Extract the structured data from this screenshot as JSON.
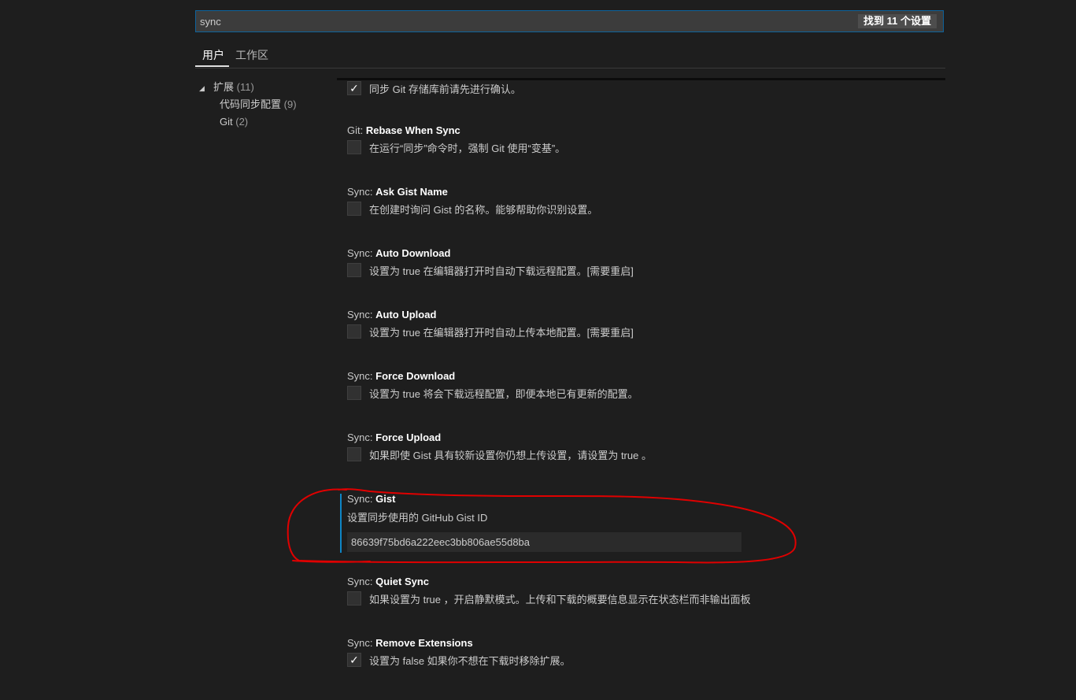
{
  "search": {
    "value": "sync",
    "result_count": "找到 11 个设置"
  },
  "tabs": [
    {
      "label": "用户"
    },
    {
      "label": "工作区"
    }
  ],
  "tree": {
    "root": {
      "label": "扩展",
      "count": "(11)"
    },
    "children": [
      {
        "label": "代码同步配置",
        "count": "(9)"
      },
      {
        "label": "Git",
        "count": "(2)"
      }
    ]
  },
  "settings": [
    {
      "category": "",
      "name": "",
      "checked": true,
      "checkmark": "✓",
      "description": "同步 Git 存储库前请先进行确认。"
    },
    {
      "category": "Git: ",
      "name": "Rebase When Sync",
      "checked": false,
      "checkmark": "",
      "description": "在运行“同步”命令时，强制 Git 使用“变基”。"
    },
    {
      "category": "Sync: ",
      "name": "Ask Gist Name",
      "checked": false,
      "checkmark": "",
      "description": "在创建时询问 Gist 的名称。能够帮助你识别设置。"
    },
    {
      "category": "Sync: ",
      "name": "Auto Download",
      "checked": false,
      "checkmark": "",
      "description": "设置为 true 在编辑器打开时自动下载远程配置。[需要重启]"
    },
    {
      "category": "Sync: ",
      "name": "Auto Upload",
      "checked": false,
      "checkmark": "",
      "description": "设置为 true 在编辑器打开时自动上传本地配置。[需要重启]"
    },
    {
      "category": "Sync: ",
      "name": "Force Download",
      "checked": false,
      "checkmark": "",
      "description": "设置为 true 将会下载远程配置，即便本地已有更新的配置。"
    },
    {
      "category": "Sync: ",
      "name": "Force Upload",
      "checked": false,
      "checkmark": "",
      "description": "如果即使 Gist 具有较新设置你仍想上传设置，请设置为 true 。"
    },
    {
      "category": "Sync: ",
      "name": "Gist",
      "description": "设置同步使用的 GitHub Gist ID",
      "value": "86639f75bd6a222eec3bb806ae55d8ba"
    },
    {
      "category": "Sync: ",
      "name": "Quiet Sync",
      "checked": false,
      "checkmark": "",
      "description": "如果设置为 true ，开启静默模式。上传和下载的概要信息显示在状态栏而非输出面板"
    },
    {
      "category": "Sync: ",
      "name": "Remove Extensions",
      "checked": true,
      "checkmark": "✓",
      "description": "设置为 false 如果你不想在下载时移除扩展。"
    }
  ],
  "colors": {
    "background": "#1e1e1e",
    "accent": "#0e639c",
    "annotation": "#e00000"
  }
}
